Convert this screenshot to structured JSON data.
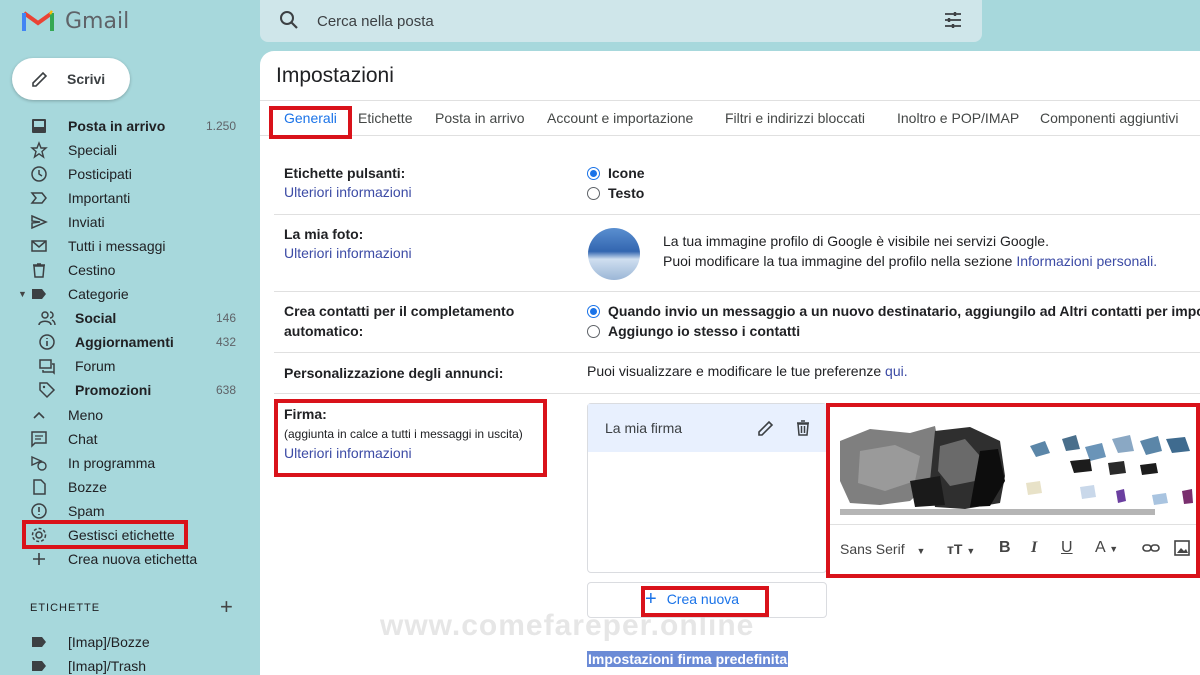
{
  "app": {
    "name": "Gmail"
  },
  "compose": {
    "label": "Scrivi"
  },
  "search": {
    "placeholder": "Cerca nella posta"
  },
  "sidebar": {
    "items": [
      {
        "label": "Posta in arrivo",
        "count": "1.250",
        "icon": "inbox-icon",
        "bold": true
      },
      {
        "label": "Speciali",
        "icon": "star-icon"
      },
      {
        "label": "Posticipati",
        "icon": "clock-icon"
      },
      {
        "label": "Importanti",
        "icon": "important-icon"
      },
      {
        "label": "Inviati",
        "icon": "send-icon"
      },
      {
        "label": "Tutti i messaggi",
        "icon": "mail-icon"
      },
      {
        "label": "Cestino",
        "icon": "trash-icon"
      },
      {
        "label": "Categorie",
        "icon": "label-icon"
      },
      {
        "label": "Social",
        "count": "146",
        "icon": "people-icon",
        "bold": true
      },
      {
        "label": "Aggiornamenti",
        "count": "432",
        "icon": "info-icon",
        "bold": true
      },
      {
        "label": "Forum",
        "icon": "forum-icon"
      },
      {
        "label": "Promozioni",
        "count": "638",
        "icon": "tag-icon",
        "bold": true
      },
      {
        "label": "Meno",
        "icon": "chevron-up-icon"
      },
      {
        "label": "Chat",
        "icon": "chat-icon"
      },
      {
        "label": "In programma",
        "icon": "scheduled-icon"
      },
      {
        "label": "Bozze",
        "icon": "draft-icon"
      },
      {
        "label": "Spam",
        "icon": "spam-icon"
      },
      {
        "label": "Gestisci etichette",
        "icon": "gear-icon"
      },
      {
        "label": "Crea nuova etichetta",
        "icon": "plus-icon"
      }
    ],
    "labels_heading": "ETICHETTE",
    "labels": [
      {
        "label": "[Imap]/Bozze",
        "icon": "label-icon"
      },
      {
        "label": "[Imap]/Trash",
        "icon": "label-icon"
      }
    ]
  },
  "settings": {
    "title": "Impostazioni",
    "tabs": [
      "Generali",
      "Etichette",
      "Posta in arrivo",
      "Account e importazione",
      "Filtri e indirizzi bloccati",
      "Inoltro e POP/IMAP",
      "Componenti aggiuntivi"
    ],
    "active_tab": "Generali",
    "button_labels": {
      "label": "Etichette pulsanti:",
      "link": "Ulteriori informazioni",
      "options": [
        "Icone",
        "Testo"
      ],
      "selected": "Icone"
    },
    "my_photo": {
      "label": "La mia foto:",
      "link": "Ulteriori informazioni",
      "line1": "La tua immagine profilo di Google è visibile nei servizi Google.",
      "line2": "Puoi modificare la tua immagine del profilo nella sezione",
      "line2_link": "Informazioni personali."
    },
    "auto_contacts": {
      "label_line1": "Crea contatti per il completamento",
      "label_line2": "automatico:",
      "options": [
        "Quando invio un messaggio a un nuovo destinatario, aggiungilo ad Altri contatti per imposta",
        "Aggiungo io stesso i contatti"
      ],
      "selected": "Quando invio un messaggio a un nuovo destinatario, aggiungilo ad Altri contatti per imposta"
    },
    "ads": {
      "label": "Personalizzazione degli annunci:",
      "text": "Puoi visualizzare e modificare le tue preferenze",
      "link": "qui."
    },
    "signature": {
      "label": "Firma:",
      "note": "(aggiunta in calce a tutti i messaggi in uscita)",
      "link": "Ulteriori informazioni",
      "items": [
        "La mia firma"
      ],
      "new_button": "Crea nuova",
      "font": "Sans Serif",
      "default_heading": "Impostazioni firma predefinita"
    }
  },
  "watermark": "www.comefareper.online",
  "colors": {
    "highlight": "#d9121a",
    "accent": "#1a73e8",
    "link": "#3c4ba5",
    "sidebar_bg": "#a7d8dc"
  }
}
